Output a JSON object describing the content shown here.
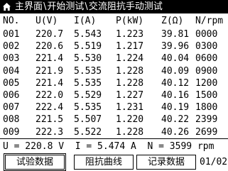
{
  "header": {
    "icon": "home-icon",
    "breadcrumbs": [
      "主界面",
      "开始测试",
      "交流阻抗手动测试"
    ],
    "separator": "\\"
  },
  "table": {
    "columns": [
      "NO.",
      "U(V)",
      "I(A)",
      "P(kW)",
      "Z(Ω)",
      "N/rpm"
    ],
    "rows": [
      [
        "001",
        "220.7",
        "5.543",
        "1.223",
        "39.81",
        "0000"
      ],
      [
        "002",
        "220.6",
        "5.519",
        "1.217",
        "39.96",
        "0300"
      ],
      [
        "003",
        "221.4",
        "5.530",
        "1.224",
        "40.04",
        "0600"
      ],
      [
        "004",
        "221.9",
        "5.535",
        "1.228",
        "40.09",
        "0900"
      ],
      [
        "005",
        "221.4",
        "5.535",
        "1.228",
        "40.12",
        "1200"
      ],
      [
        "006",
        "222.0",
        "5.529",
        "1.227",
        "40.16",
        "1500"
      ],
      [
        "007",
        "222.4",
        "5.535",
        "1.231",
        "40.19",
        "1800"
      ],
      [
        "008",
        "221.5",
        "5.507",
        "1.220",
        "40.22",
        "2399"
      ],
      [
        "009",
        "222.3",
        "5.522",
        "1.228",
        "40.26",
        "2699"
      ]
    ]
  },
  "readings": {
    "voltage": "U = 220.8 V",
    "current": "I = 5.474 A",
    "speed": "N = 3599 rpm"
  },
  "footer": {
    "buttons": [
      "试验数据",
      "阻抗曲线",
      "记录数据"
    ],
    "selected_button": "试验数据",
    "page": "01/02"
  }
}
